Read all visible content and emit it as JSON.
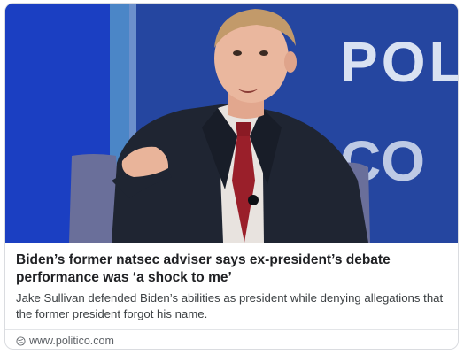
{
  "article": {
    "headline": "Biden’s former natsec adviser says ex-president’s debate performance was ‘a shock to me’",
    "description": "Jake Sullivan defended Biden’s abilities as president while denying allegations that the former president forgot his name.",
    "source": "www.politico.com"
  },
  "photo": {
    "backdrop_text": "POLIT",
    "backdrop_text_2": "CO",
    "icon": "photo-of-speaker"
  },
  "colors": {
    "backdrop_blue": "#1d3f9c",
    "text_dark": "#202124",
    "text_muted": "#5f6368"
  }
}
